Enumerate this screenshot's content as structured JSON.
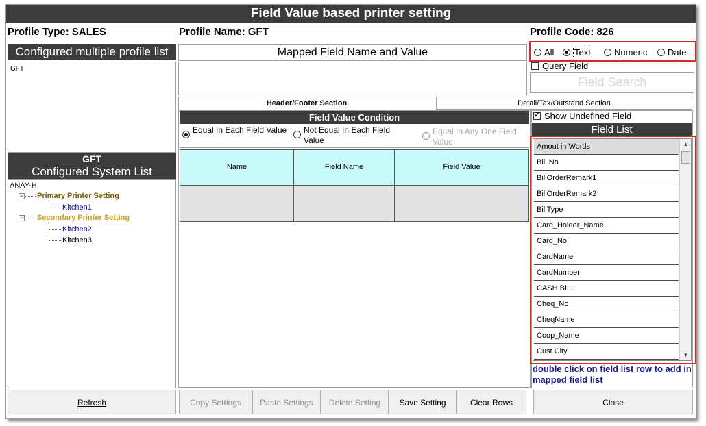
{
  "window": {
    "title": "Field Value based printer setting"
  },
  "profile": {
    "type_label": "Profile Type: SALES",
    "name_label": "Profile Name:",
    "name_value": "GFT",
    "code_label": "Profile Code: 826"
  },
  "left": {
    "configured_header": "Configured multiple profile list",
    "profiles": [
      "GFT"
    ],
    "system_title": "GFT",
    "system_header": "Configured System List",
    "tree": {
      "root": "ANAY-H",
      "primary": "Primary Printer Setting",
      "primary_children": [
        "Kitchen1"
      ],
      "secondary": "Secondary Printer Setting",
      "secondary_children": [
        "Kitchen2",
        "Kitchen3"
      ]
    }
  },
  "mapped": {
    "header": "Mapped Field Name and Value"
  },
  "filter": {
    "options": [
      "All",
      "Text",
      "Numeric",
      "Date"
    ],
    "selected": "Text",
    "query_field_label": "Query Field",
    "search_placeholder": "Field Search"
  },
  "tabs": [
    "Header/Footer Section",
    "Detail/Tax/Outstand Section"
  ],
  "condition": {
    "header": "Field Value Condition",
    "options": [
      "Equal In Each Field Value",
      "Not Equal In Each Field Value",
      "Equal In Any One Field Value"
    ],
    "selected": "Equal In Each Field Value"
  },
  "grid": {
    "columns": [
      "Name",
      "Field Name",
      "Field Value"
    ]
  },
  "field_list": {
    "show_undefined_label": "Show Undefined Field",
    "show_undefined_checked": true,
    "header": "Field List",
    "items": [
      "Amout in Words",
      "Bill No",
      "BillOrderRemark1",
      "BillOrderRemark2",
      "BillType",
      "Card_Holder_Name",
      "Card_No",
      "CardName",
      "CardNumber",
      "CASH BILL",
      "Cheq_No",
      "CheqName",
      "Coup_Name",
      "Cust City"
    ],
    "hint": "double click on field list row to add in mapped field list"
  },
  "buttons": {
    "refresh": "Refresh",
    "copy": "Copy Settings",
    "paste": "Paste Settings",
    "delete": "Delete Setting",
    "save": "Save Setting",
    "clear": "Clear Rows",
    "close": "Close"
  },
  "colors": {
    "dark_bar": "#3c3c3c",
    "grid_header": "#c8fafa",
    "grid_row": "#e2e2e2",
    "highlight": "#d42a2a",
    "hint_text": "#1a1a8c",
    "tree_primary": "#7a5a00",
    "tree_secondary": "#c8a020",
    "tree_child": "#1a1aa0"
  }
}
